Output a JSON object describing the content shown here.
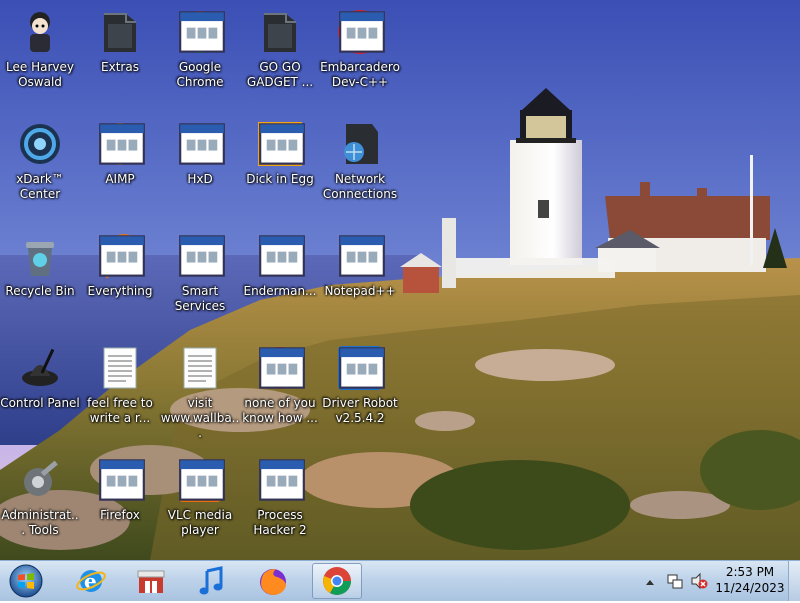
{
  "desktop": {
    "icons": [
      {
        "label": "Lee Harvey Oswald",
        "icon": "user-folder-icon"
      },
      {
        "label": "Extras",
        "icon": "folder-icon"
      },
      {
        "label": "Google Chrome",
        "icon": "chrome-icon"
      },
      {
        "label": "GO GO GADGET ...",
        "icon": "folder-icon"
      },
      {
        "label": "Embarcadero Dev-C++",
        "icon": "devcpp-icon"
      },
      {
        "label": "xDark™ Center",
        "icon": "xdark-icon"
      },
      {
        "label": "AIMP",
        "icon": "aimp-icon"
      },
      {
        "label": "HxD",
        "icon": "hxd-icon"
      },
      {
        "label": "Dick in Egg",
        "icon": "fe-icon"
      },
      {
        "label": "Network Connections",
        "icon": "network-icon"
      },
      {
        "label": "Recycle Bin",
        "icon": "recycle-bin-icon"
      },
      {
        "label": "Everything",
        "icon": "everything-icon"
      },
      {
        "label": "Smart Services",
        "icon": "services-icon"
      },
      {
        "label": "Enderman...",
        "icon": "window-icon"
      },
      {
        "label": "Notepad++",
        "icon": "notepadpp-icon"
      },
      {
        "label": "Control Panel",
        "icon": "control-panel-icon"
      },
      {
        "label": "feel free to write a r...",
        "icon": "text-file-icon"
      },
      {
        "label": "visit www.wallba...",
        "icon": "text-file-icon"
      },
      {
        "label": "none of you know how ...",
        "icon": "red-app-icon"
      },
      {
        "label": "Driver Robot v2.5.4.2",
        "icon": "driver-robot-icon"
      },
      {
        "label": "Administrat... Tools",
        "icon": "admin-tools-icon"
      },
      {
        "label": "Firefox",
        "icon": "firefox-icon"
      },
      {
        "label": "VLC media player",
        "icon": "vlc-icon"
      },
      {
        "label": "Process Hacker 2",
        "icon": "process-hacker-icon"
      }
    ]
  },
  "taskbar": {
    "start": {
      "icon": "windows-orb-icon"
    },
    "pinned": [
      {
        "icon": "internet-explorer-icon"
      },
      {
        "icon": "store-icon"
      },
      {
        "icon": "itunes-icon"
      },
      {
        "icon": "firefox-icon"
      },
      {
        "icon": "chrome-icon"
      }
    ],
    "tray": {
      "chevron_icon": "show-hidden-icons-chevron",
      "network_icon": "network-tray-icon",
      "volume_icon": "volume-muted-icon",
      "time": "2:53 PM",
      "date": "11/24/2023"
    }
  },
  "colors": {
    "sky_top": "#3b53b8",
    "sky_bottom": "#c7b3e6",
    "taskbar": "#bed3ea"
  }
}
